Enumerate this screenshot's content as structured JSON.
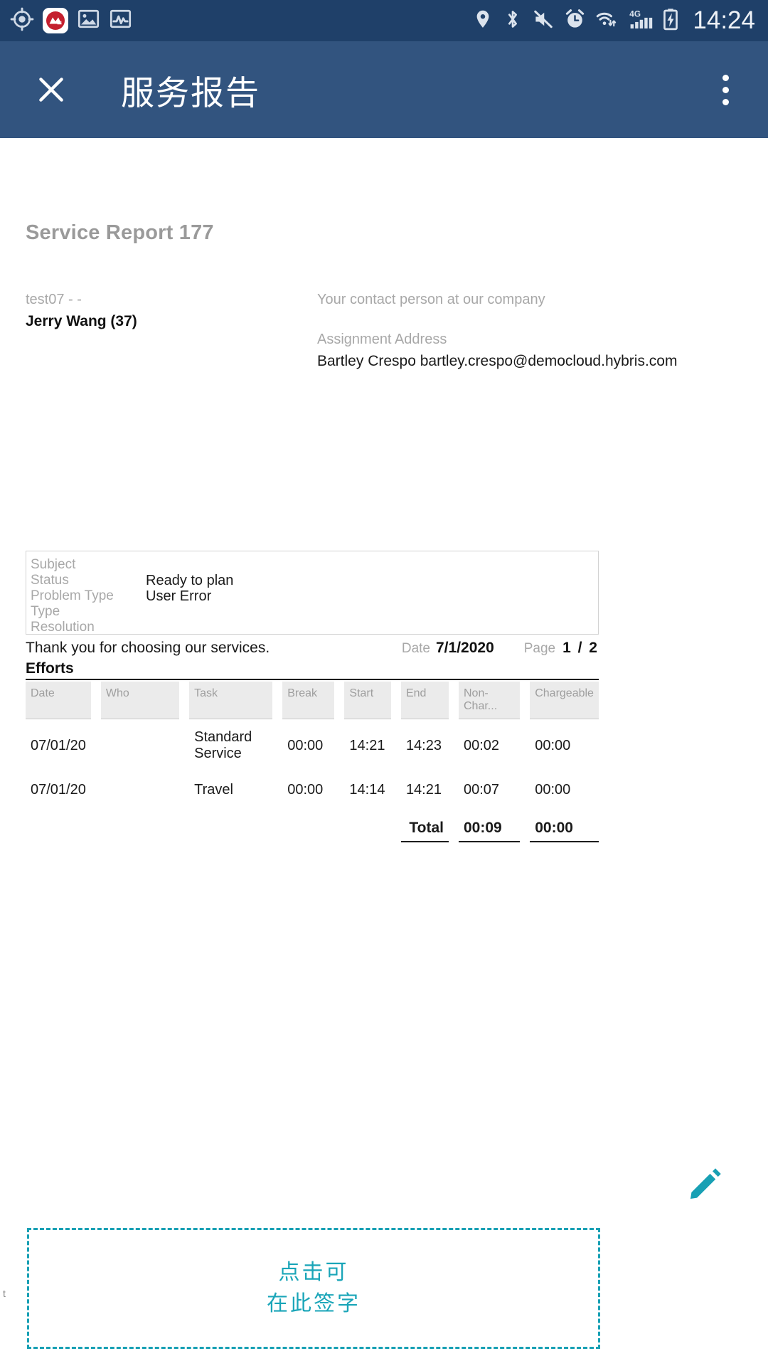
{
  "status_bar": {
    "time": "14:24",
    "left_icons": [
      {
        "name": "gps-crosshair-icon"
      },
      {
        "name": "app-logo-icon"
      },
      {
        "name": "gallery-image-icon"
      },
      {
        "name": "activity-chart-icon"
      }
    ],
    "right_icons": [
      {
        "name": "location-pin-icon"
      },
      {
        "name": "bluetooth-icon"
      },
      {
        "name": "volume-muted-icon"
      },
      {
        "name": "alarm-clock-icon"
      },
      {
        "name": "wifi-icon"
      },
      {
        "name": "mobile-signal-4g-icon",
        "label": "4G"
      },
      {
        "name": "battery-charging-icon"
      }
    ]
  },
  "app_bar": {
    "title": "服务报告",
    "close_icon": "close-icon",
    "overflow_icon": "overflow-menu-icon"
  },
  "document": {
    "title": "Service Report 177",
    "left_block": {
      "line1": "test07 -  -",
      "line2": "Jerry Wang (37)"
    },
    "right_block": {
      "contact_label": "Your contact person at our company",
      "address_label": "Assignment Address",
      "address_value": "Bartley Crespo bartley.crespo@democloud.hybris.com"
    },
    "details": [
      {
        "label": "Subject",
        "value": ""
      },
      {
        "label": "Status",
        "value": "Ready to plan"
      },
      {
        "label": "Problem Type",
        "value": "User Error"
      },
      {
        "label": "Type",
        "value": ""
      },
      {
        "label": "Resolution",
        "value": ""
      }
    ],
    "footer": {
      "thanks": "Thank you for choosing our services.",
      "date_label": "Date",
      "date_value": "7/1/2020",
      "page_label": "Page",
      "page_value": "1 / 2"
    },
    "efforts": {
      "heading": "Efforts",
      "columns": [
        "Date",
        "Who",
        "Task",
        "Break",
        "Start",
        "End",
        "Non-Char...",
        "Chargeable"
      ],
      "rows": [
        {
          "date": "07/01/20",
          "who": "",
          "task": "Standard Service",
          "break": "00:00",
          "start": "14:21",
          "end": "14:23",
          "non_chargeable": "00:02",
          "chargeable": "00:00"
        },
        {
          "date": "07/01/20",
          "who": "",
          "task": "Travel",
          "break": "00:00",
          "start": "14:14",
          "end": "14:21",
          "non_chargeable": "00:07",
          "chargeable": "00:00"
        }
      ],
      "total": {
        "label": "Total",
        "non_chargeable": "00:09",
        "chargeable": "00:00"
      }
    },
    "signature": {
      "line1": "点击可",
      "line2": "在此签字",
      "edge_mark": "t",
      "pencil_icon": "pencil-edit-icon",
      "accent_color": "#18a0b4"
    }
  }
}
